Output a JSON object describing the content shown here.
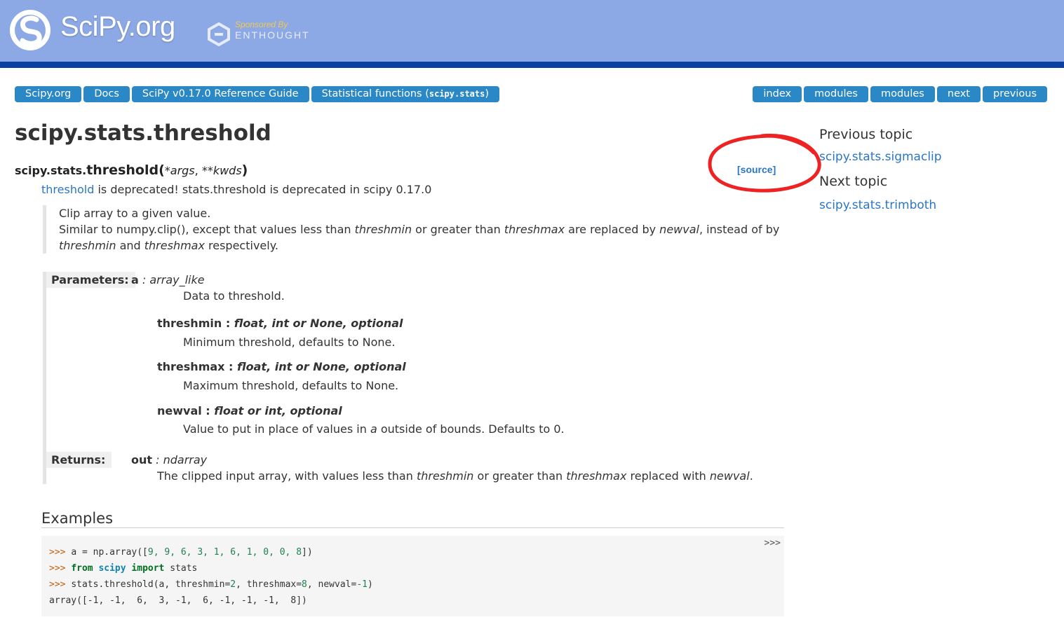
{
  "header": {
    "logo_text": "SciPy.org",
    "sponsor_by": "Sponsored By",
    "sponsor_name": "ENTHOUGHT"
  },
  "nav_left": {
    "items": [
      "Scipy.org",
      "Docs",
      "SciPy v0.17.0 Reference Guide",
      "Statistical functions ("
    ],
    "stats_code": "scipy.stats",
    "stats_close": ")"
  },
  "nav_right": {
    "items": [
      "index",
      "modules",
      "modules",
      "next",
      "previous"
    ]
  },
  "page": {
    "title": "scipy.stats.threshold",
    "sig_module": "scipy.stats.",
    "sig_name": "threshold",
    "sig_open": "(",
    "sig_args": "*args",
    "sig_sep": ", ",
    "sig_kwds": "**kwds",
    "sig_close": ")",
    "source_link": "[source]",
    "deprecated_link": "threshold",
    "deprecated_text": " is deprecated! stats.threshold is deprecated in scipy 0.17.0",
    "desc1": "Clip array to a given value.",
    "desc2_a": "Similar to numpy.clip(), except that values less than ",
    "desc2_b": "threshmin",
    "desc2_c": " or greater than ",
    "desc2_d": "threshmax",
    "desc2_e": " are replaced by ",
    "desc2_f": "newval",
    "desc2_g": ", instead of by",
    "desc3_a": "threshmin",
    "desc3_b": " and ",
    "desc3_c": "threshmax",
    "desc3_d": " respectively."
  },
  "params": {
    "label": "Parameters:",
    "a_name": "a",
    "a_type": " : array_like",
    "a_desc": "Data to threshold.",
    "threshmin_name": "threshmin : ",
    "threshmin_type": "float, int or None, optional",
    "threshmin_desc": "Minimum threshold, defaults to None.",
    "threshmax_name": "threshmax : ",
    "threshmax_type": "float, int or None, optional",
    "threshmax_desc": "Maximum threshold, defaults to None.",
    "newval_name": "newval : ",
    "newval_type": "float or int, optional",
    "newval_desc_a": "Value to put in place of values in ",
    "newval_desc_b": "a",
    "newval_desc_c": " outside of bounds. Defaults to 0."
  },
  "returns": {
    "label": "Returns:",
    "out_name": "out",
    "out_type": " : ndarray",
    "desc_a": "The clipped input array, with values less than ",
    "desc_b": "threshmin",
    "desc_c": " or greater than ",
    "desc_d": "threshmax",
    "desc_e": " replaced with ",
    "desc_f": "newval",
    "desc_g": "."
  },
  "examples": {
    "title": "Examples",
    "copy_button": ">>>",
    "prompt": ">>> ",
    "line1_a": "a = np.array([",
    "line1_nums": "9, 9, 6, 3, 1, 6, 1, 0, 0, 8",
    "line1_b": "])",
    "line2_from": "from",
    "line2_mod": "scipy",
    "line2_import": "import",
    "line2_rest": " stats",
    "line3_a": "stats.threshold(a, threshmin=",
    "line3_n1": "2",
    "line3_b": ", threshmax=",
    "line3_n2": "8",
    "line3_c": ", newval=",
    "line3_n3": "-1",
    "line3_d": ")",
    "output": "array([-1, -1,  6,  3, -1,  6, -1, -1, -1,  8])"
  },
  "sidebar": {
    "previous_heading": "Previous topic",
    "previous_link": "scipy.stats.sigmaclip",
    "next_heading": "Next topic",
    "next_link": "scipy.stats.trimboth"
  },
  "colors": {
    "header_bg": "#8ca9e6",
    "header_strip": "#0b3fa0",
    "nav_button": "#2a88c6",
    "link": "#2a76c6",
    "annotation_circle": "#ee2222"
  }
}
